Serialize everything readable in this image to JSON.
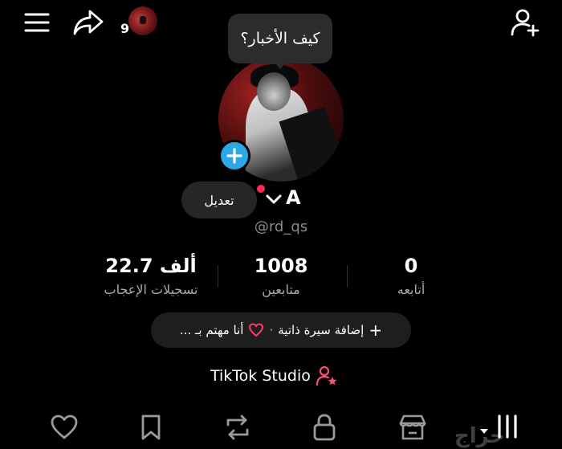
{
  "header": {
    "notification_count": "9"
  },
  "bubble": {
    "text": "كيف الأخبار؟"
  },
  "profile": {
    "name": "A",
    "handle": "@rd_qs",
    "edit_label": "تعديل"
  },
  "stats": [
    {
      "value": "22.7 ألف",
      "label": "تسجيلات الإعجاب"
    },
    {
      "value": "1008",
      "label": "متابعين"
    },
    {
      "value": "0",
      "label": "أتابعه"
    }
  ],
  "bio": {
    "add_label": "إضافة سيرة ذاتية",
    "separator": "·",
    "interest_label": "أنا مهتم بـ ..."
  },
  "studio": {
    "label": "TikTok Studio"
  },
  "watermark": {
    "text": "حراج"
  },
  "colors": {
    "accent_blue": "#2aa9e6",
    "accent_pink": "#fe2c55",
    "background": "#000000"
  },
  "icons": {
    "menu": "hamburger-icon",
    "share": "share-arrow-icon",
    "add_friend": "add-user-icon",
    "tabs": [
      "heart-icon",
      "bookmark-icon",
      "repost-icon",
      "lock-icon",
      "shop-icon",
      "videos-grid-icon"
    ]
  }
}
